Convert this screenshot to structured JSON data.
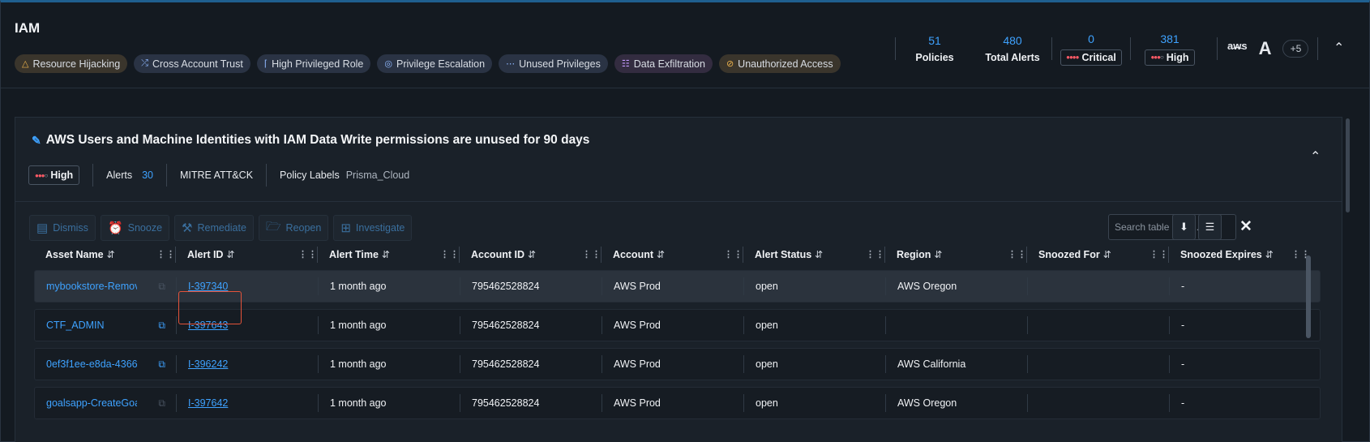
{
  "header": {
    "title": "IAM",
    "chips": [
      {
        "label": "Resource Hijacking",
        "icon": "fire-icon"
      },
      {
        "label": "Cross Account Trust",
        "icon": "shuffle-icon"
      },
      {
        "label": "High Privileged Role",
        "icon": "role-icon"
      },
      {
        "label": "Privilege Escalation",
        "icon": "fingerprint-icon"
      },
      {
        "label": "Unused Privileges",
        "icon": "dots-icon"
      },
      {
        "label": "Data Exfiltration",
        "icon": "database-icon"
      },
      {
        "label": "Unauthorized Access",
        "icon": "block-icon"
      }
    ],
    "stats": {
      "policies": {
        "value": "51",
        "label": "Policies"
      },
      "total_alerts": {
        "value": "480",
        "label": "Total Alerts"
      },
      "critical": {
        "value": "0",
        "label": "Critical"
      },
      "high": {
        "value": "381",
        "label": "High"
      }
    },
    "cloud": {
      "aws": "aws",
      "more": "+5"
    }
  },
  "policy": {
    "title": "AWS Users and Machine Identities with IAM Data Write permissions are unused for 90 days",
    "severity": "High",
    "alerts_label": "Alerts",
    "alerts_count": "30",
    "mitre": "MITRE ATT&CK",
    "labels_key": "Policy Labels",
    "labels_value": "Prisma_Cloud"
  },
  "toolbar": {
    "dismiss": "Dismiss",
    "snooze": "Snooze",
    "remediate": "Remediate",
    "reopen": "Reopen",
    "investigate": "Investigate",
    "search_placeholder": "Search table data..."
  },
  "table": {
    "columns": [
      "Asset Name",
      "Alert ID",
      "Alert Time",
      "Account ID",
      "Account",
      "Alert Status",
      "Region",
      "Snoozed For",
      "Snoozed Expires"
    ],
    "rows": [
      {
        "asset": "mybookstore-RemoveBook",
        "alert_id": "I-397340",
        "time": "1 month ago",
        "account_id": "795462528824",
        "account": "AWS Prod",
        "status": "open",
        "region": "AWS Oregon",
        "snoozed_for": "",
        "snoozed_expires": "-"
      },
      {
        "asset": "CTF_ADMIN",
        "alert_id": "I-397643",
        "time": "1 month ago",
        "account_id": "795462528824",
        "account": "AWS Prod",
        "status": "open",
        "region": "",
        "snoozed_for": "",
        "snoozed_expires": "-"
      },
      {
        "asset": "0ef3f1ee-e8da-4366",
        "alert_id": "I-396242",
        "time": "1 month ago",
        "account_id": "795462528824",
        "account": "AWS Prod",
        "status": "open",
        "region": "AWS California",
        "snoozed_for": "",
        "snoozed_expires": "-"
      },
      {
        "asset": "goalsapp-CreateGoal",
        "alert_id": "I-397642",
        "time": "1 month ago",
        "account_id": "795462528824",
        "account": "AWS Prod",
        "status": "open",
        "region": "AWS Oregon",
        "snoozed_for": "",
        "snoozed_expires": "-"
      }
    ]
  },
  "colors": {
    "accent": "#3ea2ff",
    "critical": "#ff5a66",
    "highlight": "#e5533a"
  }
}
